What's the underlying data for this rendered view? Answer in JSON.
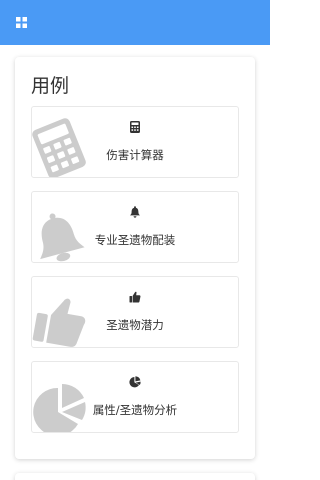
{
  "header": {
    "menu_icon": "grid-icon",
    "color": "#4a9af5"
  },
  "card": {
    "title": "用例",
    "items": [
      {
        "label": "伤害计算器",
        "icon": "calculator-icon"
      },
      {
        "label": "专业圣遗物配装",
        "icon": "bell-icon"
      },
      {
        "label": "圣遗物潜力",
        "icon": "thumbs-up-icon"
      },
      {
        "label": "属性/圣遗物分析",
        "icon": "pie-chart-icon"
      }
    ]
  }
}
